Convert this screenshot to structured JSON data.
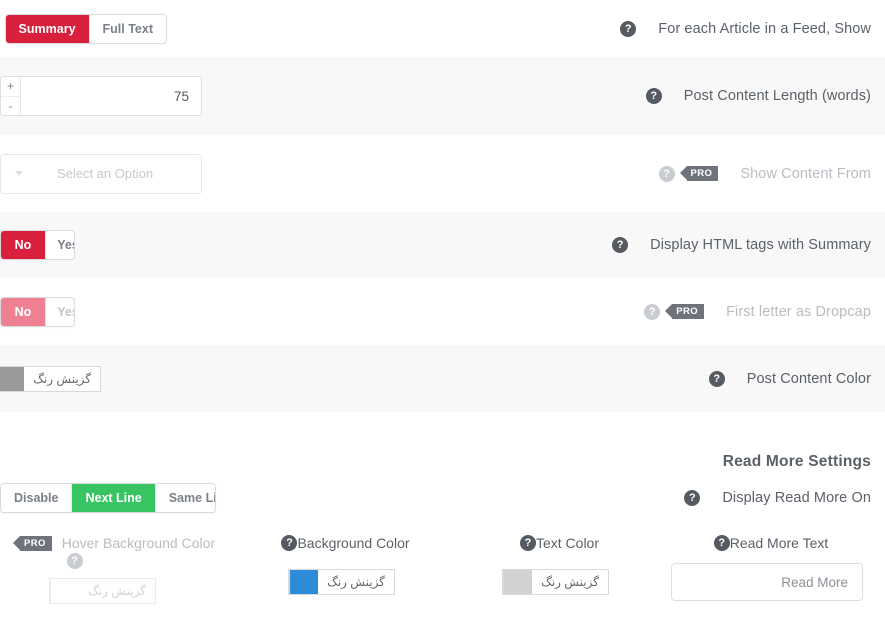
{
  "colors": {
    "accent_red": "#d8203c",
    "accent_green": "#38c463",
    "pro_gray": "#6f747c",
    "row_alt": "#f8f8f8",
    "swatch_content_color": "#9a9a9a",
    "swatch_background_color": "#2e8bd8",
    "swatch_text_color": "#d2d2d2",
    "swatch_hover_background_color": "#ffffff"
  },
  "icons": {
    "help": "help-circle-icon",
    "caret": "chevron-down-icon",
    "plus": "plus-icon",
    "minus": "minus-icon"
  },
  "glyphs": {
    "help": "?",
    "plus": "+",
    "minus": "-"
  },
  "badges": {
    "pro": "PRO"
  },
  "rows": [
    {
      "label": "For each Article in a Feed, Show",
      "control": "segmented",
      "options": [
        "Summary",
        "Full Text"
      ],
      "selected": "Summary"
    },
    {
      "label": "Post Content Length (words)",
      "control": "number",
      "value": "75"
    },
    {
      "label": "Show Content From",
      "control": "select",
      "placeholder": "Select an Option",
      "pro": true
    },
    {
      "label": "Display HTML tags with Summary",
      "control": "segmented",
      "options": [
        "No",
        "Yes"
      ],
      "selected": "No"
    },
    {
      "label": "First letter as Dropcap",
      "control": "segmented",
      "options": [
        "No",
        "Yes"
      ],
      "selected": "No",
      "pro": true
    },
    {
      "label": "Post Content Color",
      "control": "colorpicker",
      "picker_label": "گزینش رنگ"
    }
  ],
  "section": {
    "heading": "Read More Settings",
    "display_row": {
      "label": "Display Read More On",
      "options": [
        "Disable",
        "Next Line",
        "Same Line"
      ],
      "selected": "Next Line"
    },
    "cells": [
      {
        "label": "Read More Text",
        "control": "text",
        "value": "Read More"
      },
      {
        "label": "Text Color",
        "control": "colorpicker",
        "picker_label": "گزینش رنگ"
      },
      {
        "label": "Background Color",
        "control": "colorpicker",
        "picker_label": "گزینش رنگ"
      },
      {
        "label": "Hover Background Color",
        "control": "colorpicker",
        "picker_label": "گزینش رنگ",
        "pro": true
      }
    ]
  }
}
